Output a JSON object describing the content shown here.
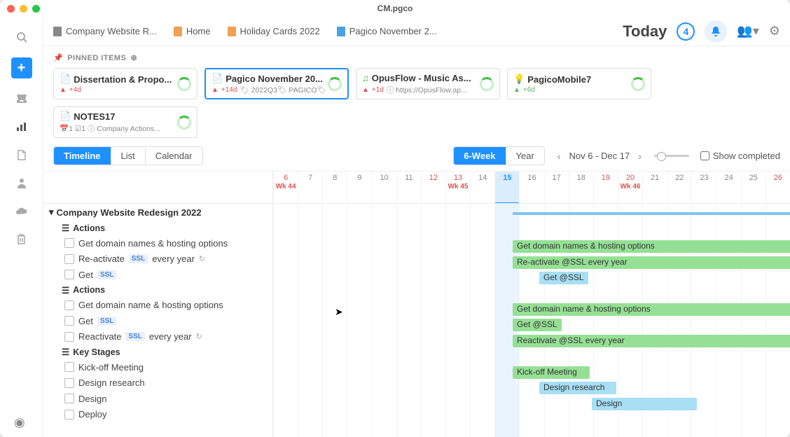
{
  "window_title": "CM.pgco",
  "tabs": [
    {
      "label": "Company Website R...",
      "color": "#888"
    },
    {
      "label": "Home",
      "color": "#f0a050"
    },
    {
      "label": "Holiday Cards 2022",
      "color": "#f0a050"
    },
    {
      "label": "Pagico November 2...",
      "color": "#4aa3df"
    }
  ],
  "today_label": "Today",
  "today_count": "4",
  "pinned_header": "PINNED ITEMS",
  "pinned": [
    {
      "title": "Dissertation & Propo...",
      "meta_warn": "+4d",
      "meta_extra": "",
      "icon": "📄"
    },
    {
      "title": "Pagico November 20...",
      "meta_warn": "+14d",
      "meta_extra": "🏷 2022Q3🏷 PAGICO🏷",
      "icon": "📄",
      "active": true
    },
    {
      "title": "OpusFlow - Music As...",
      "meta_warn": "+1d",
      "meta_extra": "ⓘ https://OpusFlow.ap...",
      "icon": "🎵"
    },
    {
      "title": "PagicoMobile7",
      "meta_green": "+6d",
      "meta_extra": "",
      "icon": "💡"
    },
    {
      "title": "NOTES17",
      "meta_extra": "📅1 ☑1 ⓘ Company Actions...",
      "icon": "📄"
    }
  ],
  "view_tabs": [
    "Timeline",
    "List",
    "Calendar"
  ],
  "zoom_tabs": [
    "6-Week",
    "Year"
  ],
  "date_range": "Nov 6 - Dec 17",
  "show_completed": "Show completed",
  "dates": [
    {
      "d": "6",
      "cls": "sun",
      "wk": "Wk 44",
      "wkcls": "red"
    },
    {
      "d": "7"
    },
    {
      "d": "8"
    },
    {
      "d": "9"
    },
    {
      "d": "10"
    },
    {
      "d": "11"
    },
    {
      "d": "12",
      "cls": "sun"
    },
    {
      "d": "13",
      "cls": "sun",
      "wk": "Wk 45",
      "wkcls": "red"
    },
    {
      "d": "14"
    },
    {
      "d": "15",
      "cls": "today"
    },
    {
      "d": "16"
    },
    {
      "d": "17"
    },
    {
      "d": "18"
    },
    {
      "d": "19",
      "cls": "sun"
    },
    {
      "d": "20",
      "cls": "sun",
      "wk": "Wk 46",
      "wkcls": "red"
    },
    {
      "d": "21"
    },
    {
      "d": "22"
    },
    {
      "d": "23"
    },
    {
      "d": "24"
    },
    {
      "d": "25"
    },
    {
      "d": "26",
      "cls": "sun"
    }
  ],
  "today_text": "Today",
  "project_name": "Company Website Redesign 2022",
  "sections": [
    {
      "name": "Actions",
      "tasks": [
        {
          "label": "Get domain names & hosting options"
        },
        {
          "label_pre": "Re-activate",
          "ssl": "SSL",
          "label_post": "every year",
          "repeat": true
        },
        {
          "label_pre": "Get",
          "ssl": "SSL"
        }
      ]
    },
    {
      "name": "Actions",
      "tasks": [
        {
          "label": "Get domain name & hosting options"
        },
        {
          "label_pre": "Get",
          "ssl": "SSL"
        },
        {
          "label_pre": "Reactivate",
          "ssl": "SSL",
          "label_post": "every year",
          "repeat": true
        }
      ]
    },
    {
      "name": "Key Stages",
      "tasks": [
        {
          "label": "Kick-off Meeting"
        },
        {
          "label": "Design research"
        },
        {
          "label": "Design"
        },
        {
          "label": "Deploy"
        }
      ]
    }
  ],
  "bars": [
    {
      "label": "Get domain names & hosting options"
    },
    {
      "label": "Re-activate @SSL every year"
    },
    {
      "label": "Get @SSL"
    },
    {
      "label": "Get domain name & hosting options"
    },
    {
      "label": "Get @SSL"
    },
    {
      "label": "Reactivate @SSL every year"
    },
    {
      "label": "Kick-off Meeting"
    },
    {
      "label": "Design research"
    },
    {
      "label": "Design"
    }
  ]
}
